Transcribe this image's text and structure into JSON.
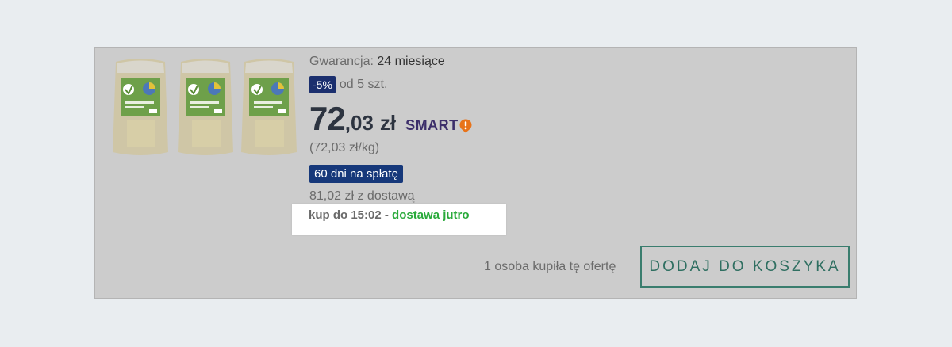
{
  "offer": {
    "warranty_label": "Gwarancja:",
    "warranty_value": "24 miesiące",
    "discount_badge": "-5%",
    "discount_condition": "od 5 szt.",
    "price_integer": "72",
    "price_decimal": ",03",
    "price_currency": "zł",
    "smart_label": "SMART",
    "unit_price": "(72,03 zł/kg)",
    "installments_badge": "60 dni na spłatę",
    "price_with_delivery": "81,02 zł z dostawą",
    "deadline_prefix": "kup do 15:02 -",
    "deadline_delivery": "dostawa jutro",
    "buyers_text": "1 osoba kupiła tę ofertę",
    "add_to_cart_label": "DODAJ DO KOSZYKA"
  },
  "thumbnail": {
    "icon": "product-pack-icon",
    "count": 3
  },
  "colors": {
    "page_bg": "#e9edf0",
    "card_bg": "#cccccc",
    "discount_badge_bg": "#1b2f6e",
    "installments_badge_bg": "#16387a",
    "delivery_green": "#2aaa3b",
    "cart_button_border": "#3a7d6e",
    "smart_purple": "#3c2e6a",
    "smart_orange": "#e8731a"
  }
}
